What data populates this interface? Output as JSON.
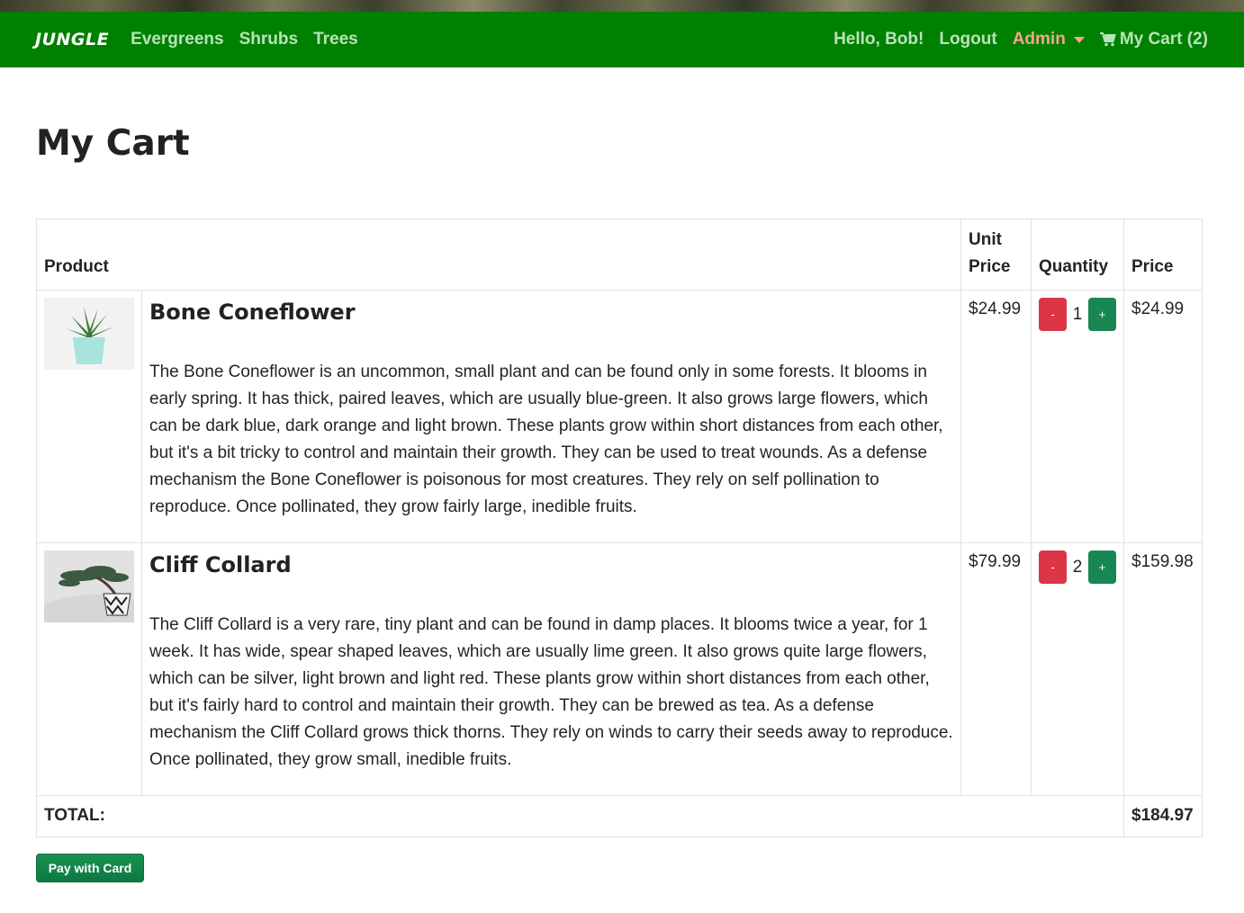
{
  "nav": {
    "brand": "JUNGLE",
    "links": [
      "Evergreens",
      "Shrubs",
      "Trees"
    ],
    "greeting": "Hello, Bob!",
    "logout": "Logout",
    "admin": "Admin",
    "cart": "My Cart (2)"
  },
  "page": {
    "title": "My Cart"
  },
  "table": {
    "headers": {
      "product": "Product",
      "unit_price": "Unit Price",
      "quantity": "Quantity",
      "price": "Price"
    },
    "items": [
      {
        "name": "Bone Coneflower",
        "description": "The Bone Coneflower is an uncommon, small plant and can be found only in some forests. It blooms in early spring. It has thick, paired leaves, which are usually blue-green. It also grows large flowers, which can be dark blue, dark orange and light brown. These plants grow within short distances from each other, but it's a bit tricky to control and maintain their growth. They can be used to treat wounds. As a defense mechanism the Bone Coneflower is poisonous for most creatures. They rely on self pollination to reproduce. Once pollinated, they grow fairly large, inedible fruits.",
        "unit_price": "$24.99",
        "quantity": "1",
        "price": "$24.99",
        "minus": "-",
        "plus": "+"
      },
      {
        "name": "Cliff Collard",
        "description": "The Cliff Collard is a very rare, tiny plant and can be found in damp places. It blooms twice a year, for 1 week. It has wide, spear shaped leaves, which are usually lime green. It also grows quite large flowers, which can be silver, light brown and light red. These plants grow within short distances from each other, but it's fairly hard to control and maintain their growth. They can be brewed as tea. As a defense mechanism the Cliff Collard grows thick thorns. They rely on winds to carry their seeds away to reproduce. Once pollinated, they grow small, inedible fruits.",
        "unit_price": "$79.99",
        "quantity": "2",
        "price": "$159.98",
        "minus": "-",
        "plus": "+"
      }
    ],
    "total_label": "TOTAL:",
    "total_value": "$184.97"
  },
  "pay_button": "Pay with Card",
  "colors": {
    "navbar": "#008000",
    "admin": "#f4a58a",
    "minus": "#dc3545",
    "plus": "#198754"
  }
}
